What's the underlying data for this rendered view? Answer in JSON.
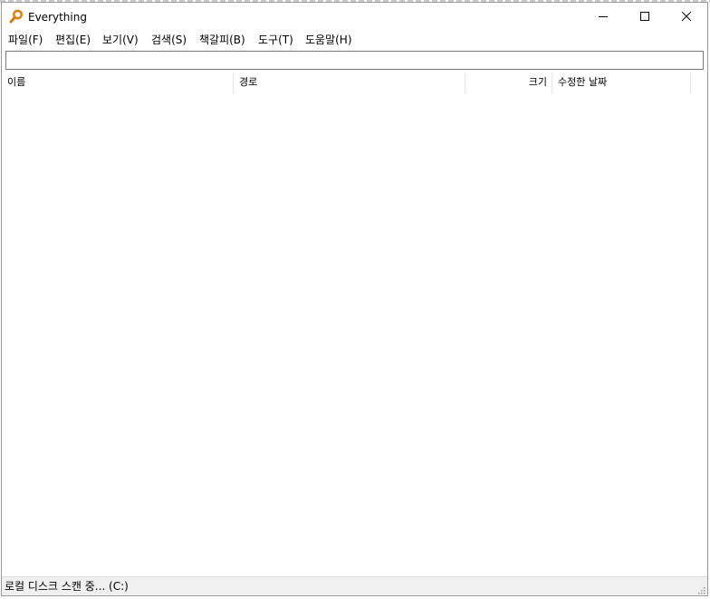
{
  "window": {
    "title": "Everything",
    "icons": {
      "app": "magnifier-icon",
      "minimize": "minimize-icon",
      "maximize": "maximize-icon",
      "close": "close-icon"
    }
  },
  "menu": [
    {
      "label": "파일(F)"
    },
    {
      "label": "편집(E)"
    },
    {
      "label": "보기(V)"
    },
    {
      "label": "검색(S)"
    },
    {
      "label": "책갈피(B)"
    },
    {
      "label": "도구(T)"
    },
    {
      "label": "도움말(H)"
    }
  ],
  "search": {
    "value": "",
    "placeholder": ""
  },
  "columns": {
    "name": "이름",
    "path": "경로",
    "size": "크기",
    "modified": "수정한 날짜"
  },
  "rows": [],
  "status": {
    "text": "로컬 디스크 스캔 중... (C:)"
  },
  "colors": {
    "accent": "#e07b00",
    "status_bg": "#f0f0f0"
  }
}
